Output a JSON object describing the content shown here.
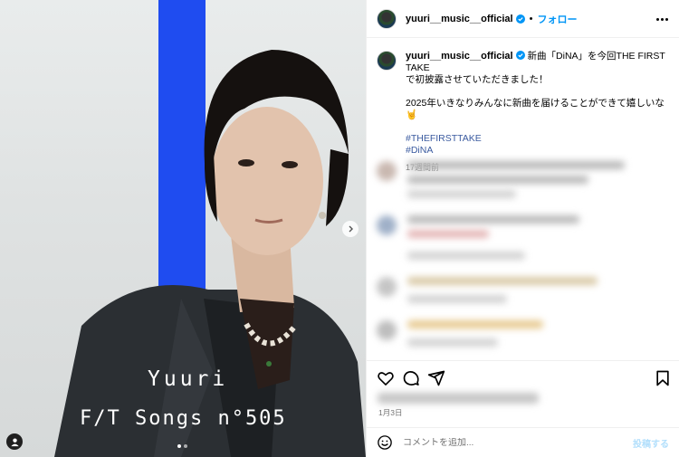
{
  "media": {
    "overlay_name": "Yuuri",
    "overlay_songs": "F/T Songs n°505",
    "carousel_count": 2,
    "carousel_active": 1,
    "icons": {
      "next": "chevron-right-icon",
      "user_tag": "user-tag-icon"
    },
    "colors": {
      "stripe": "#1f4cf0",
      "background": "#e0e3e3"
    }
  },
  "post": {
    "header": {
      "username": "yuuri__music__official",
      "separator": "•",
      "follow_label": "フォロー",
      "more_icon": "more-options-icon"
    },
    "caption": {
      "username": "yuuri__music__official",
      "text_line1": "新曲「DiNA」を今回THE FIRST TAKE",
      "text_line2": "で初披露させていただきました！",
      "text_line3": "2025年いきなりみんなに新曲を届けることができて嬉しいな🤘",
      "hashtag1": "#THEFIRSTTAKE",
      "hashtag2": "#DiNA",
      "time_ago": "17週間前"
    },
    "actions": {
      "like_icon": "heart-icon",
      "comment_icon": "comment-icon",
      "share_icon": "share-icon",
      "save_icon": "bookmark-icon"
    },
    "date": "1月3日",
    "comment_input": {
      "placeholder": "コメントを追加...",
      "post_label": "投稿する",
      "emoji_icon": "emoji-icon"
    },
    "colors": {
      "link": "#0095f6",
      "hashtag": "#3a5a9f",
      "muted": "#737373"
    }
  }
}
